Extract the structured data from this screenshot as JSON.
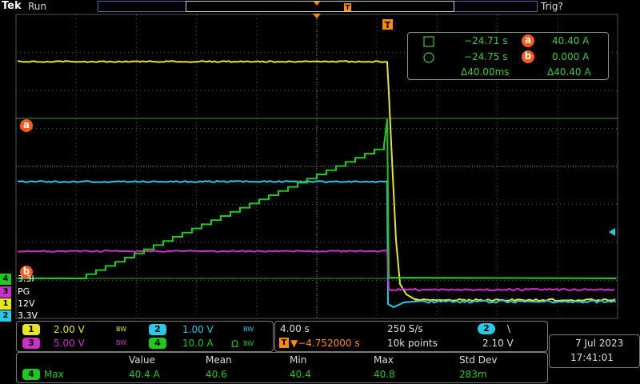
{
  "header": {
    "brand": "Tek",
    "run_state": "Run",
    "trigger_state": "Trig?"
  },
  "cursor_readout": {
    "a_time": "−24.71 s",
    "a_value": "40.40 A",
    "b_time": "−24.75 s",
    "b_value": "0.000 A",
    "delta_time": "Δ40.00ms",
    "delta_value": "Δ40.40 A",
    "a_label": "a",
    "b_label": "b"
  },
  "channel_labels": [
    {
      "num": "4",
      "text": "3.3I",
      "color": "#1ec81e"
    },
    {
      "num": "3",
      "text": "PG",
      "color": "#c832c8"
    },
    {
      "num": "1",
      "text": "12V",
      "color": "#e6e61e"
    },
    {
      "num": "2",
      "text": "3.3V",
      "color": "#28c8e6"
    }
  ],
  "trigger_marker": "T",
  "channels_panel": {
    "ch1": {
      "num": "1",
      "scale": "2.00 V",
      "bw": "BW"
    },
    "ch2": {
      "num": "2",
      "scale": "1.00 V",
      "bw": "BW"
    },
    "ch3": {
      "num": "3",
      "scale": "5.00 V",
      "bw": "BW"
    },
    "ch4": {
      "num": "4",
      "scale": "10.0 A",
      "bw": "BW"
    }
  },
  "timebase": {
    "horiz_scale": "4.00 s",
    "sample_rate": "250 S/s",
    "trigger_pos": "▼−4.752000 s",
    "record_length": "10k points",
    "trigger_ch": "2",
    "trigger_slope": "\\",
    "trigger_level": "2.10 V"
  },
  "datetime": {
    "date": "7 Jul  2023",
    "time": "17:41:01"
  },
  "measurements": {
    "headers": [
      "Value",
      "Mean",
      "Min",
      "Max",
      "Std Dev"
    ],
    "row": {
      "ch": "4",
      "type": "Max",
      "values": [
        "40.4 A",
        "40.6",
        "40.4",
        "40.8",
        "283m"
      ]
    }
  },
  "colors": {
    "ch1": "#e6e61e",
    "ch2": "#28c8e6",
    "ch3": "#c832c8",
    "ch4": "#1ec81e",
    "cursor": "#ff5a1a",
    "grid": "#6a6a6a"
  }
}
